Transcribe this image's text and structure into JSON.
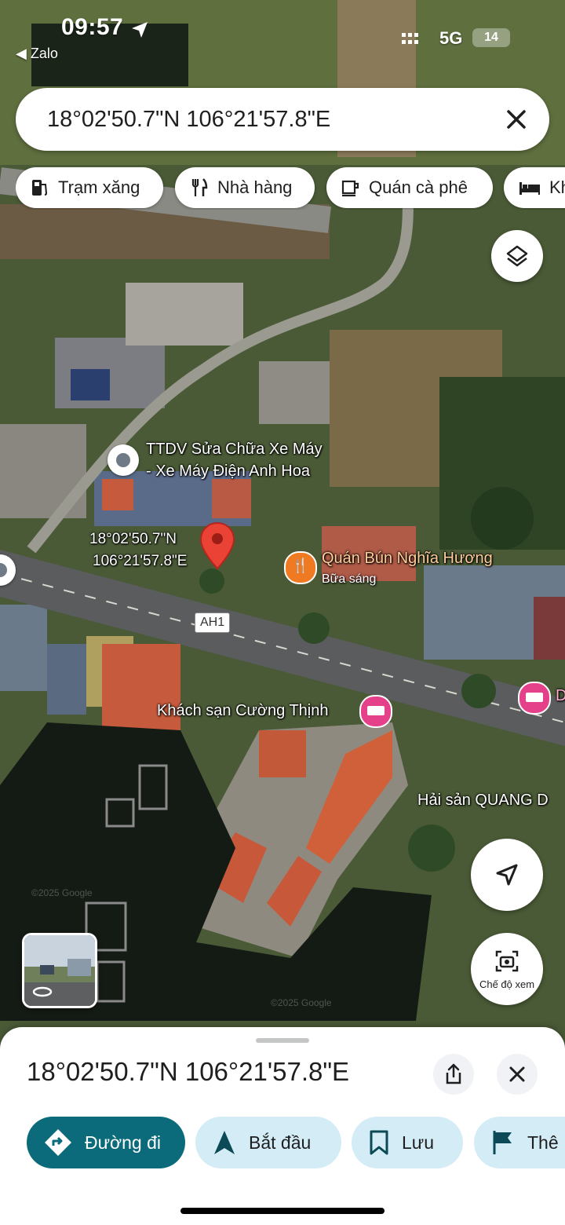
{
  "status_bar": {
    "time": "09:57",
    "back_app": "◀ Zalo",
    "network": "5G",
    "battery": "14"
  },
  "search": {
    "value": "18°02'50.7\"N 106°21'57.8\"E"
  },
  "chips": [
    {
      "label": "Trạm xăng",
      "icon": "gas-station-icon"
    },
    {
      "label": "Nhà hàng",
      "icon": "restaurant-icon"
    },
    {
      "label": "Quán cà phê",
      "icon": "coffee-icon"
    },
    {
      "label": "Kh",
      "icon": "hotel-icon"
    }
  ],
  "map": {
    "pin_label_line1": "18°02'50.7\"N",
    "pin_label_line2": "106°21'57.8\"E",
    "places": {
      "repair_line1": "TTDV Sửa Chữa Xe Máy",
      "repair_line2": "- Xe Máy Điện Anh Hoa",
      "noodle": "Quán Bún Nghĩa Hương",
      "noodle_sub": "Bữa sáng",
      "hotel": "Khách sạn Cường Thịnh",
      "seafood": "Hải sản QUANG D",
      "right_edge": "D"
    },
    "road": "AH1",
    "watermark": "©2025 Google"
  },
  "view_mode": {
    "label": "Chế độ xem"
  },
  "sheet": {
    "title": "18°02'50.7\"N 106°21'57.8\"E",
    "actions": [
      {
        "label": "Đường đi",
        "icon": "directions-icon"
      },
      {
        "label": "Bắt đầu",
        "icon": "navigation-arrow-icon"
      },
      {
        "label": "Lưu",
        "icon": "bookmark-icon"
      },
      {
        "label": "Thê",
        "icon": "flag-icon"
      }
    ]
  },
  "colors": {
    "accent": "#0b6b7a",
    "chip_bg": "#d3ecf5",
    "pin": "#ea4335"
  }
}
